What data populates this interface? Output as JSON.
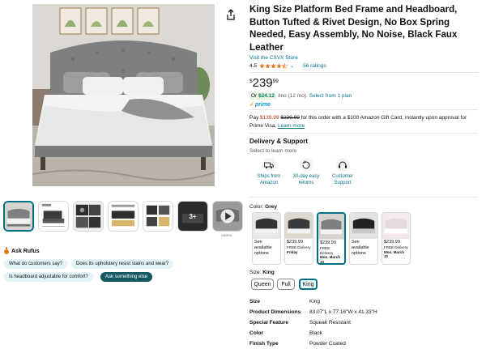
{
  "product": {
    "title": "King Size Platform Bed Frame and Headboard, Button Tufted & Rivet Design, No Box Spring Needed, Easy Assembly, No Noise, Black Faux Leather",
    "store_link": "Visit the CXVX Store",
    "rating_value": "4.5",
    "stars": 4.5,
    "ratings_count": "56 ratings"
  },
  "gallery": {
    "thumbnails": [
      {
        "name": "bed-front"
      },
      {
        "name": "bed-dimensions"
      },
      {
        "name": "bed-detail"
      },
      {
        "name": "bed-storage"
      },
      {
        "name": "bed-hardware"
      },
      {
        "name": "more-images",
        "badge": "3+"
      },
      {
        "name": "video",
        "label": "VIDEO"
      }
    ]
  },
  "rufus": {
    "title": "Ask Rufus",
    "chips": [
      "What do customers say?",
      "Does its upholstery resist stains and wear?",
      "Is headboard adjustable for comfort?",
      "Ask something else"
    ]
  },
  "price": {
    "symbol": "$",
    "whole": "239",
    "fraction": "99"
  },
  "financing": {
    "or_text": "Or",
    "monthly_amount": "$24.12",
    "monthly_rest": "/mo (12 mo).",
    "select_plan": "Select from 1 plan",
    "prime_label": "prime"
  },
  "promo": {
    "pay_prefix": "Pay",
    "new_price": "$139.99",
    "old_price": "$239.99",
    "text": "for this order with a $100 Amazon Gift Card, instantly upon approval for Prime Visa.",
    "learn_more": "Learn more"
  },
  "delivery": {
    "title": "Delivery & Support",
    "subtitle": "Select to learn more",
    "features": [
      {
        "label": "Ships from Amazon",
        "icon": "truck-icon"
      },
      {
        "label": "30-day easy returns",
        "icon": "return-icon"
      },
      {
        "label": "Customer Support",
        "icon": "headset-icon"
      }
    ]
  },
  "color": {
    "label": "Color:",
    "value": "Grey",
    "options": [
      {
        "line1": "See available options",
        "line2": "",
        "line3": ""
      },
      {
        "line1": "$239.99",
        "line2": "FREE Delivery",
        "line3": "Friday"
      },
      {
        "line1": "$239.99",
        "line2": "FREE Delivery",
        "line3": "Mon, March 10"
      },
      {
        "line1": "See available options",
        "line2": "",
        "line3": ""
      },
      {
        "line1": "$239.99",
        "line2": "FREE Delivery",
        "line3": "Mon, March 10"
      }
    ]
  },
  "size": {
    "label": "Size:",
    "value": "King",
    "options": [
      "Queen",
      "Full",
      "King"
    ]
  },
  "specs": [
    {
      "key": "Size",
      "value": "King"
    },
    {
      "key": "Product Dimensions",
      "value": "83.07\"L x 77.16\"W x 41.33\"H"
    },
    {
      "key": "Special Feature",
      "value": "Squeak Resistant"
    },
    {
      "key": "Color",
      "value": "Black"
    },
    {
      "key": "Finish Type",
      "value": "Powder Coated"
    }
  ],
  "colors": {
    "link": "#007185",
    "price_red": "#b12704",
    "selected_border": "#007185",
    "prime_blue": "#1399d6",
    "rufus_dark": "#155862",
    "rufus_light": "#e3f4f7"
  }
}
